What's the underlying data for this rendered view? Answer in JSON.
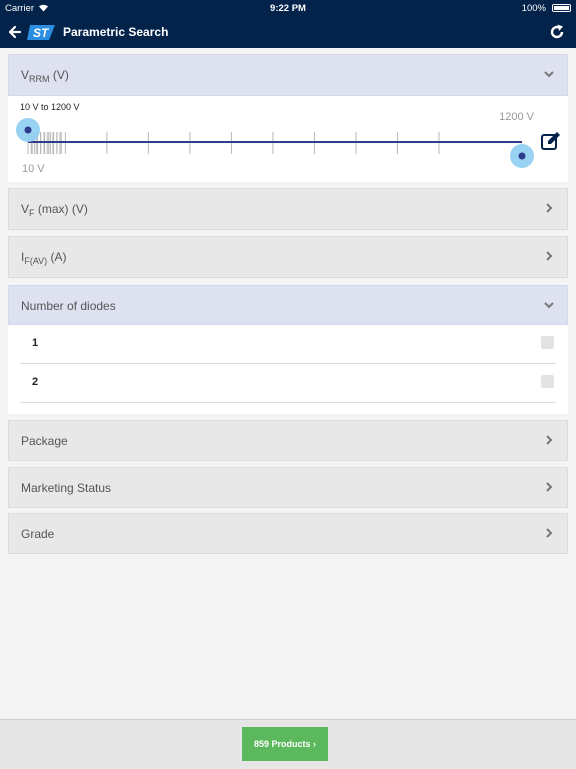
{
  "status_bar": {
    "carrier": "Carrier",
    "time": "9:22 PM",
    "battery": "100%"
  },
  "nav": {
    "title": "Parametric Search",
    "logo_text": "ST"
  },
  "sections": {
    "vrrm": {
      "label_main": "V",
      "label_sub": "RRM",
      "label_unit": " (V)"
    },
    "vf": {
      "label_main": "V",
      "label_sub": "F",
      "label_unit": " (max) (V)"
    },
    "ifav": {
      "label_main": "I",
      "label_sub": "F(AV)",
      "label_unit": " (A)"
    },
    "diodes": {
      "label": "Number of diodes"
    },
    "package": {
      "label": "Package"
    },
    "marketing": {
      "label": "Marketing Status"
    },
    "grade": {
      "label": "Grade"
    }
  },
  "slider": {
    "range_text": "10 V to 1200 V",
    "min_label": "10 V",
    "max_label": "1200 V",
    "low_value": 10,
    "high_value": 1200,
    "scale": "log"
  },
  "diode_options": [
    {
      "label": "1",
      "checked": false
    },
    {
      "label": "2",
      "checked": false
    }
  ],
  "footer": {
    "products_button": "859 Products"
  },
  "colors": {
    "header": "#03234b",
    "accent": "#2e3a8c",
    "button": "#5cb85c",
    "open_section": "#dde1f0"
  }
}
